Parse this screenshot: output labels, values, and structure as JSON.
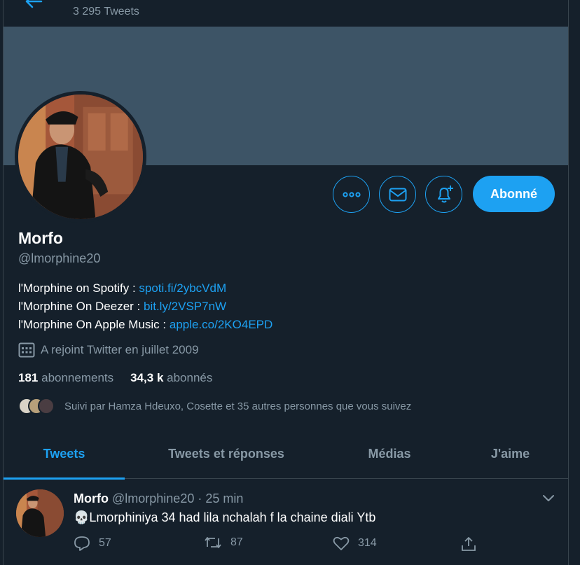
{
  "header": {
    "tweet_count": "3 295 Tweets"
  },
  "profile": {
    "name": "Morfo",
    "handle": "@lmorphine20",
    "bio": [
      {
        "text": "l'Morphine on Spotify : ",
        "link": "spoti.fi/2ybcVdM"
      },
      {
        "text": "l'Morphine On Deezer : ",
        "link": "bit.ly/2VSP7nW"
      },
      {
        "text": "l'Morphine On Apple Music : ",
        "link": "apple.co/2KO4EPD"
      }
    ],
    "joined": "A rejoint Twitter en juillet 2009",
    "following_count": "181",
    "following_label": "abonnements",
    "followers_count": "34,3 k",
    "followers_label": "abonnés",
    "followed_by": "Suivi par Hamza Hdeuxo, Cosette et 35 autres personnes que vous suivez",
    "follow_button": "Abonné"
  },
  "tabs": [
    "Tweets",
    "Tweets et réponses",
    "Médias",
    "J'aime"
  ],
  "tweet": {
    "name": "Morfo",
    "handle": "@lmorphine20",
    "separator": "·",
    "time": "25 min",
    "emoji": "💀",
    "text": "Lmorphiniya 34 had lila nchalah f la chaine diali Ytb",
    "replies": "57",
    "retweets": "87",
    "likes": "314"
  },
  "icons": {
    "more": "more-icon",
    "message": "mail-icon",
    "notify": "bell-plus-icon",
    "calendar": "calendar-icon",
    "reply": "reply-icon",
    "retweet": "retweet-icon",
    "like": "heart-icon",
    "share": "share-icon",
    "chevron": "chevron-down-icon",
    "back": "back-arrow-icon"
  },
  "colors": {
    "accent": "#1da1f2",
    "background": "#15202b",
    "banner": "#3d5466",
    "muted": "#8899a6"
  }
}
